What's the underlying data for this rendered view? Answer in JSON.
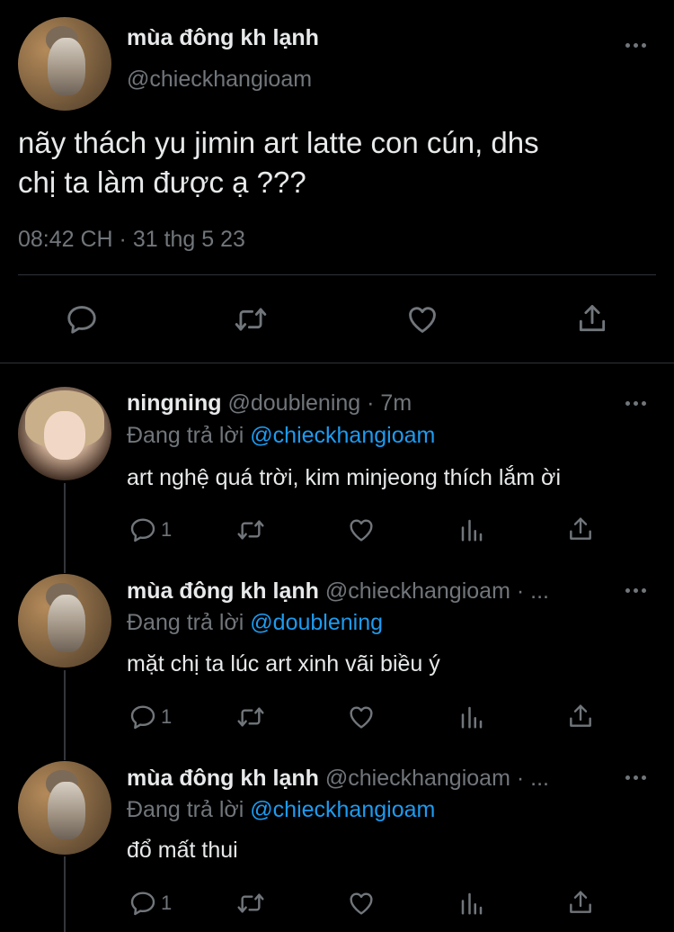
{
  "main_tweet": {
    "display_name": "mùa đông kh lạnh",
    "handle": "@chieckhangioam",
    "text_line1": "nãy thách yu jimin art latte con cún, dhs",
    "text_line2": "chị ta làm được ạ ???",
    "timestamp": "08:42 CH · 31 thg 5 23"
  },
  "replies": [
    {
      "display_name": "ningning",
      "meta": "@doublening · 7m",
      "replying_prefix": "Đang trả lời ",
      "replying_to": "@chieckhangioam",
      "text": "art nghệ quá trời, kim minjeong thích lắm ời",
      "reply_count": "1"
    },
    {
      "display_name": "mùa đông kh lạnh",
      "meta": "@chieckhangioam · ...",
      "replying_prefix": "Đang trả lời ",
      "replying_to": "@doublening",
      "text": "mặt chị ta lúc art xinh vãi biều ý",
      "reply_count": "1"
    },
    {
      "display_name": "mùa đông kh lạnh",
      "meta": "@chieckhangioam · ...",
      "replying_prefix": "Đang trả lời ",
      "replying_to": "@chieckhangioam",
      "text": "đổ mất thui",
      "reply_count": "1"
    }
  ],
  "icons": {
    "reply": "reply-icon",
    "retweet": "retweet-icon",
    "like": "heart-icon",
    "views": "views-icon",
    "share": "share-icon",
    "more": "more-options-icon"
  },
  "colors": {
    "background": "#000000",
    "text": "#e7e9ea",
    "muted": "#71767b",
    "link": "#1d9bf0",
    "divider": "#2f3336"
  }
}
